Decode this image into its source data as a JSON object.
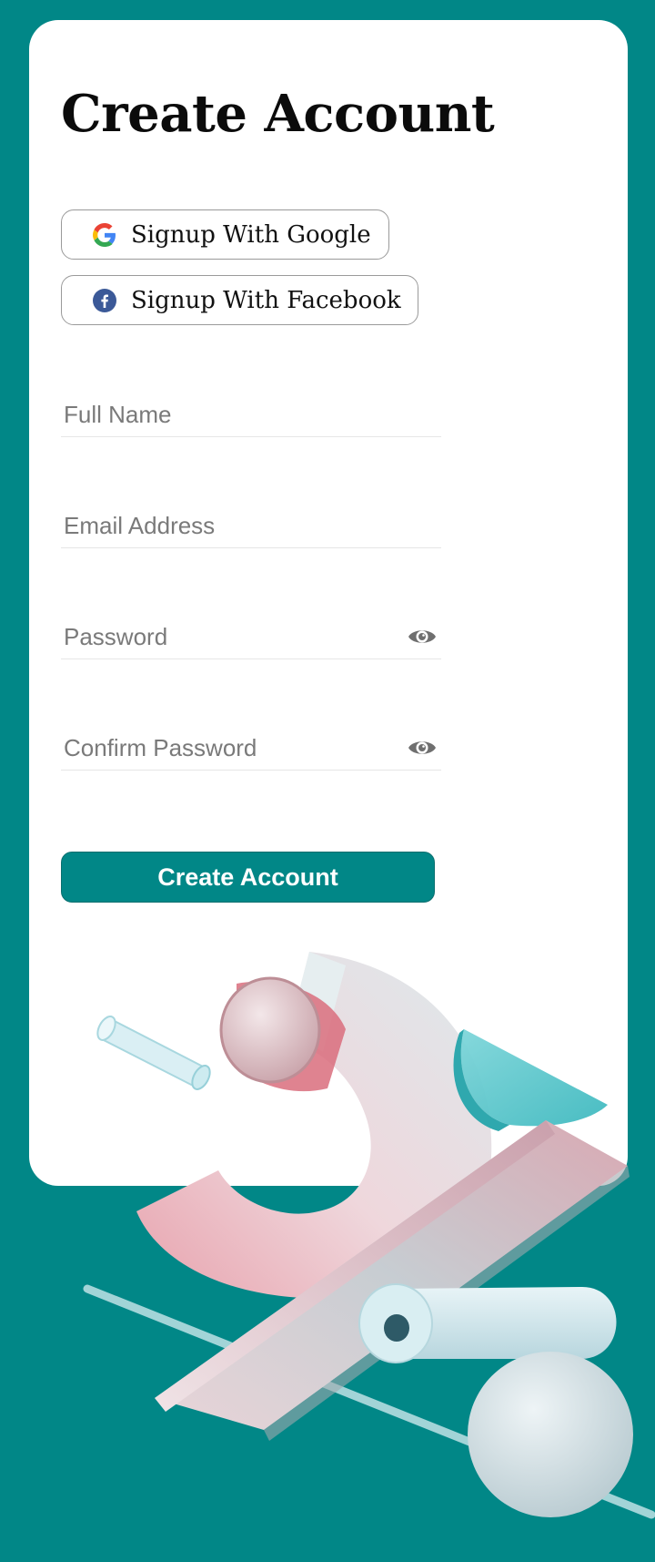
{
  "page": {
    "title": "Create Account"
  },
  "social": {
    "google_label": "Signup With Google",
    "facebook_label": "Signup With Facebook"
  },
  "form": {
    "full_name_placeholder": "Full Name",
    "email_placeholder": "Email Address",
    "password_placeholder": "Password",
    "confirm_password_placeholder": "Confirm Password",
    "submit_label": "Create Account"
  },
  "icons": {
    "google": "google-icon",
    "facebook": "facebook-icon",
    "eye": "eye-icon"
  },
  "colors": {
    "background": "#018787",
    "card": "#ffffff",
    "primary_button": "#018787",
    "facebook_blue": "#3b5998"
  }
}
